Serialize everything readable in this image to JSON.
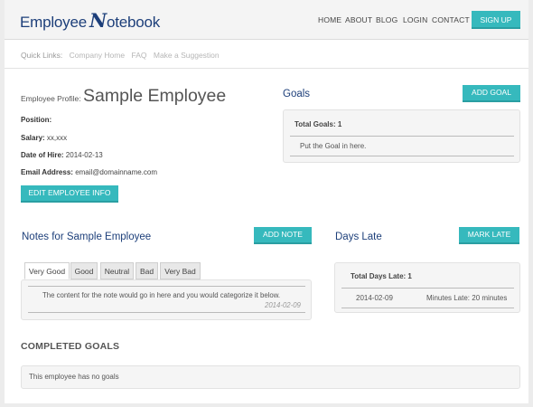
{
  "header": {
    "logo_text": "Employee",
    "logo_mark": "N",
    "logo_rest": "otebook",
    "nav": [
      "HOME",
      "ABOUT",
      "BLOG",
      "LOGIN",
      "CONTACT"
    ],
    "signup_label": "SIGN UP"
  },
  "quick_links": {
    "title": "Quick Links:",
    "items": [
      "Company Home",
      "FAQ",
      "Make a Suggestion"
    ]
  },
  "profile": {
    "label": "Employee Profile:",
    "name": "Sample Employee",
    "position_label": "Position:",
    "position_value": "",
    "salary_label": "Salary:",
    "salary_value": "xx,xxx",
    "hire_label": "Date of Hire:",
    "hire_value": "2014-02-13",
    "email_label": "Email Address:",
    "email_value": "email@domainname.com",
    "edit_button": "EDIT EMPLOYEE INFO"
  },
  "goals": {
    "title": "Goals",
    "add_button": "ADD GOAL",
    "total_label": "Total Goals: 1",
    "items": [
      "Put the Goal in here."
    ]
  },
  "notes": {
    "title": "Notes for Sample Employee",
    "add_button": "ADD NOTE",
    "tabs": [
      "Very Good",
      "Good",
      "Neutral",
      "Bad",
      "Very Bad"
    ],
    "active_tab": "Very Good",
    "note_text": "The content for the note would go in here and you would categorize it below.",
    "note_date": "2014-02-09"
  },
  "days_late": {
    "title": "Days Late",
    "mark_button": "MARK LATE",
    "total_label": "Total Days Late: 1",
    "entry_date": "2014-02-09",
    "entry_minutes": "Minutes Late: 20 minutes"
  },
  "completed": {
    "title": "COMPLETED GOALS",
    "empty_text": "This employee has no goals"
  },
  "colors": {
    "accent": "#36b9bd",
    "brand": "#1d3f7a"
  }
}
